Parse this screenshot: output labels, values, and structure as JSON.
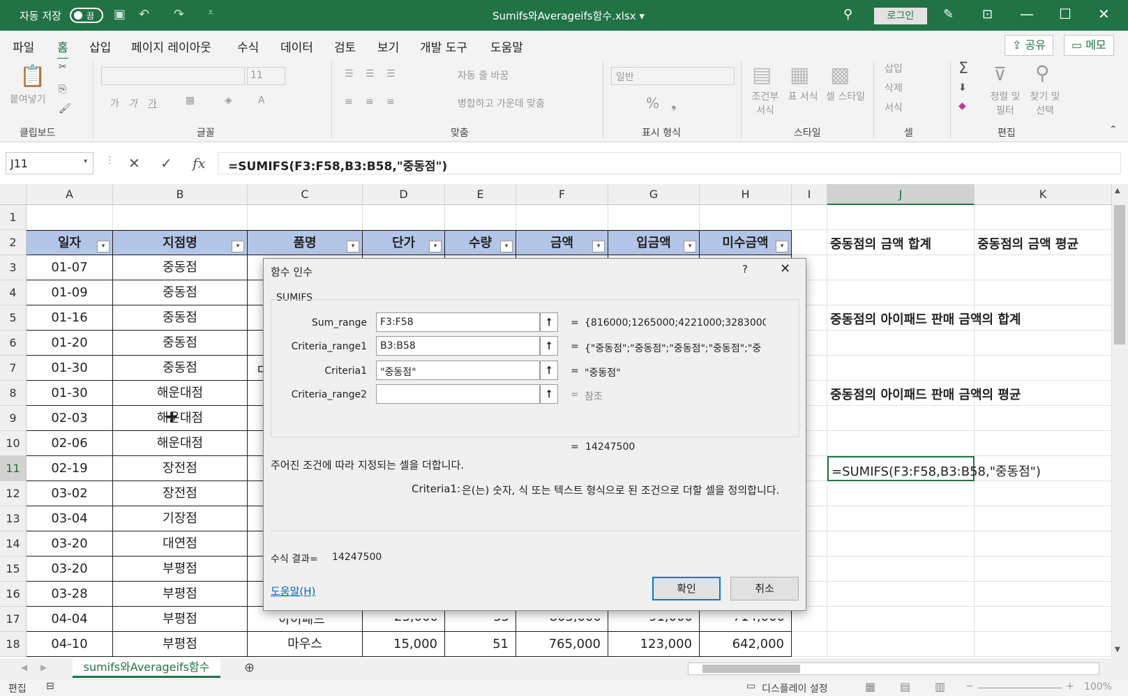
{
  "titlebar": {
    "autosave_label": "자동 저장",
    "autosave_state": "끔",
    "filename": "Sumifs와Averageifs함수.xlsx ▾",
    "login_label": "로그인"
  },
  "menu": {
    "tabs": [
      "파일",
      "홈",
      "삽입",
      "페이지 레이아웃",
      "수식",
      "데이터",
      "검토",
      "보기",
      "개발 도구",
      "도움말"
    ],
    "active_tab": "홈",
    "share_label": "공유",
    "memo_label": "메모"
  },
  "ribbon": {
    "clipboard": {
      "paste": "붙여넣기",
      "group": "클립보드"
    },
    "font": {
      "font_size": "11",
      "group": "글꼴",
      "bold": "가",
      "italic": "가",
      "underline": "가"
    },
    "alignment": {
      "wrap_text": "자동 줄 바꿈",
      "merge_center": "병합하고 가운데 맞춤",
      "group": "맞춤"
    },
    "number": {
      "format": "일반",
      "group": "표시 형식"
    },
    "styles": {
      "conditional": "조건부 서식",
      "table": "표 서식",
      "cell_style": "셀 스타일",
      "group": "스타일"
    },
    "cells": {
      "insert": "삽입",
      "delete": "삭제",
      "format": "서식",
      "group": "셀"
    },
    "editing": {
      "sort_filter": "정렬 및 필터",
      "find_select": "찾기 및 선택",
      "group": "편집"
    }
  },
  "formula_bar": {
    "name_box": "J11",
    "fx_label": "fx",
    "formula": "=SUMIFS(F3:F58,B3:B58,\"중동점\")"
  },
  "sheet": {
    "columns": [
      "A",
      "B",
      "C",
      "D",
      "E",
      "F",
      "G",
      "H",
      "I",
      "J",
      "K"
    ],
    "rows": [
      "1",
      "2",
      "3",
      "4",
      "5",
      "6",
      "7",
      "8",
      "9",
      "10",
      "11",
      "12",
      "13",
      "14",
      "15",
      "16",
      "17",
      "18"
    ],
    "headers": [
      "일자",
      "지점명",
      "품명",
      "단가",
      "수량",
      "금액",
      "입금액",
      "미수금액"
    ],
    "data": [
      {
        "date": "01-07",
        "branch": "중동점"
      },
      {
        "date": "01-09",
        "branch": "중동점"
      },
      {
        "date": "01-16",
        "branch": "중동점"
      },
      {
        "date": "01-20",
        "branch": "중동점"
      },
      {
        "date": "01-30",
        "branch": "중동점"
      },
      {
        "date": "01-30",
        "branch": "해운대점"
      },
      {
        "date": "02-03",
        "branch": "해운대점"
      },
      {
        "date": "02-06",
        "branch": "해운대점"
      },
      {
        "date": "02-19",
        "branch": "장전점"
      },
      {
        "date": "03-02",
        "branch": "장전점"
      },
      {
        "date": "03-04",
        "branch": "기장점"
      },
      {
        "date": "03-20",
        "branch": "대연점"
      },
      {
        "date": "03-20",
        "branch": "부평점"
      },
      {
        "date": "03-28",
        "branch": "부평점"
      },
      {
        "date": "04-04",
        "branch": "부평점"
      },
      {
        "date": "04-10",
        "branch": "부평점",
        "item": "마우스",
        "price": "15,000",
        "qty": "51",
        "amount": "765,000",
        "paid": "123,000",
        "unpaid": "642,000"
      }
    ],
    "row17_partial": {
      "item": "아이패드",
      "price": "23,000",
      "qty": "35",
      "amount": "805,000",
      "paid": "91,000",
      "unpaid": "714,000"
    },
    "c7_partial": "ㅁ",
    "j_labels": {
      "j2": "중동점의 금액 합계",
      "k2": "중동점의 금액 평균",
      "j5": "중동점의 아이패드 판매 금액의 합계",
      "j8": "중동점의 아이패드 판매 금액의 평균"
    },
    "active_cell_text": "=SUMIFS(F3:F58,B3:B58,\"중동점\")"
  },
  "dialog": {
    "title": "함수 인수",
    "help_q": "?",
    "function_name": "SUMIFS",
    "args": [
      {
        "label": "Sum_range",
        "value": "F3:F58",
        "result": "{816000;1265000;4221000;3283000;3280"
      },
      {
        "label": "Criteria_range1",
        "value": "B3:B58",
        "result": "{\"중동점\";\"중동점\";\"중동점\";\"중동점\";\"중"
      },
      {
        "label": "Criteria1",
        "value": "\"중동점\"",
        "result": "\"중동점\""
      },
      {
        "label": "Criteria_range2",
        "value": "",
        "result": "참조"
      }
    ],
    "overall_result": "14247500",
    "description": "주어진 조건에 따라 지정되는 셀을 더합니다.",
    "arg_help_name": "Criteria1:",
    "arg_help_text": "은(는) 숫자, 식 또는 텍스트 형식으로 된 조건으로 더할 셀을 정의합니다.",
    "formula_result_label": "수식 결과=",
    "formula_result_value": "14247500",
    "help_link": "도움말(H)",
    "ok_label": "확인",
    "cancel_label": "취소"
  },
  "tabs": {
    "sheet_name": "sumifs와Averageifs함수"
  },
  "status": {
    "mode": "편집",
    "display_settings": "디스플레이 설정",
    "zoom": "100%"
  }
}
